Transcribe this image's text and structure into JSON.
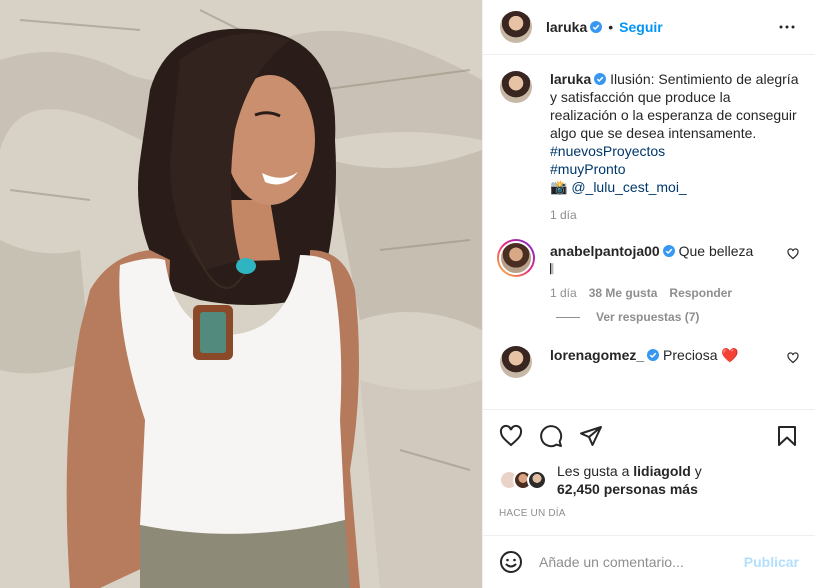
{
  "post": {
    "author": "laruka",
    "follow_label": "Seguir",
    "separator": "•",
    "more_icon": "ellipsis-icon"
  },
  "caption": {
    "author": "laruka",
    "text": "Ilusión: Sentimiento de alegría y satisfacción que produce la realización o la esperanza de conseguir algo que se desea intensamente.",
    "hashtags": [
      "#nuevosProyectos",
      "#muyPronto"
    ],
    "credit_emoji": "📸",
    "credit_handle": "@_lulu_cest_moi_",
    "time": "1 día"
  },
  "comments": [
    {
      "author": "anabelpantoja00",
      "text": "Que belleza",
      "emoji": "𝄃",
      "time": "1 día",
      "likes": "38 Me gusta",
      "reply_label": "Responder",
      "view_replies": "Ver respuestas (7)"
    },
    {
      "author": "lorenagomez_",
      "text": "Preciosa",
      "emoji": "❤️"
    }
  ],
  "likes": {
    "prefix": "Les gusta a",
    "user": "lidiagold",
    "suffix": "y",
    "count": "62,450 personas más"
  },
  "timestamp": "HACE UN DÍA",
  "composer": {
    "placeholder": "Añade un comentario...",
    "publish_label": "Publicar"
  },
  "colors": {
    "accent": "#0095f6",
    "verified": "#3897f0",
    "hashtag": "#00376b",
    "muted": "#8e8e8e",
    "publish_disabled": "#b2dffc"
  }
}
